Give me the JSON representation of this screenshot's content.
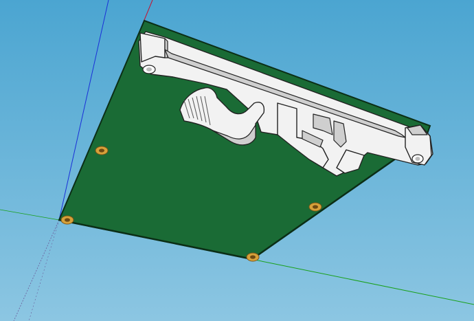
{
  "viewport": {
    "sky_top": "#4ba5d1",
    "sky_bottom": "#8cc6e2"
  },
  "axes": {
    "red_axis": "#c8102e",
    "green_axis": "#18a018",
    "blue_axis": "#1a2fd8"
  },
  "pcb": {
    "board_color": "#1a6b35",
    "board_edge_color": "#0b2e16",
    "mounting_holes": 4,
    "hole_ring_color": "#d7a13a"
  },
  "din_rail_clip": {
    "part_color": "#f2f2f2",
    "part_shade": "#cfcfcf",
    "outline_color": "#222222"
  }
}
